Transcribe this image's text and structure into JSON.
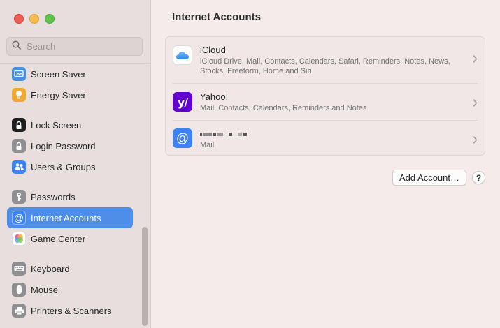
{
  "search": {
    "placeholder": "Search",
    "value": ""
  },
  "sidebar": {
    "items": [
      {
        "label": "Screen Saver",
        "icon": "screen-saver-icon",
        "color": "#4a8ee0"
      },
      {
        "label": "Energy Saver",
        "icon": "energy-saver-icon",
        "color": "#f0a92e"
      },
      {
        "label": "Lock Screen",
        "icon": "lock-screen-icon",
        "color": "#1f1f1f"
      },
      {
        "label": "Login Password",
        "icon": "login-password-icon",
        "color": "#8e8e93"
      },
      {
        "label": "Users & Groups",
        "icon": "users-groups-icon",
        "color": "#3b82f6"
      },
      {
        "label": "Passwords",
        "icon": "passwords-icon",
        "color": "#8e8e93"
      },
      {
        "label": "Internet Accounts",
        "icon": "internet-accounts-icon",
        "color": "#3b82f6",
        "selected": true
      },
      {
        "label": "Game Center",
        "icon": "game-center-icon",
        "color": "#ffffff"
      },
      {
        "label": "Keyboard",
        "icon": "keyboard-icon",
        "color": "#8e8e93"
      },
      {
        "label": "Mouse",
        "icon": "mouse-icon",
        "color": "#8e8e93"
      },
      {
        "label": "Printers & Scanners",
        "icon": "printers-scanners-icon",
        "color": "#8e8e93"
      }
    ]
  },
  "main": {
    "title": "Internet Accounts",
    "accounts": [
      {
        "name": "iCloud",
        "detail": "iCloud Drive, Mail, Contacts, Calendars, Safari, Reminders, Notes, News, Stocks, Freeform, Home and Siri",
        "icon": "icloud-icon"
      },
      {
        "name": "Yahoo!",
        "detail": "Mail, Contacts, Calendars, Reminders and Notes",
        "icon": "yahoo-icon",
        "color": "#6001d2"
      },
      {
        "name": "",
        "detail": "Mail",
        "icon": "mail-at-icon",
        "color": "#3b82f6",
        "name_redacted": true
      }
    ],
    "add_account_label": "Add Account…",
    "help_label": "?"
  }
}
